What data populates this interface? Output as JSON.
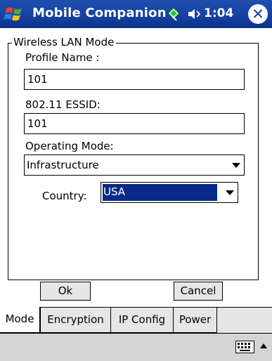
{
  "titlebar": {
    "app_title": "Mobile Companion",
    "clock": "1:04",
    "close_label": "✕",
    "start_icon": "windows-flag-icon",
    "connectivity_icon": "connectivity-icon",
    "volume_icon": "speaker-icon"
  },
  "form": {
    "group_label": "Wireless LAN Mode",
    "profile_name_label": "Profile Name :",
    "profile_name_value": "101",
    "essid_label": "802.11 ESSID:",
    "essid_value": "101",
    "operating_mode_label": "Operating Mode:",
    "operating_mode_value": "Infrastructure",
    "country_label": "Country:",
    "country_value": "USA"
  },
  "buttons": {
    "ok": "Ok",
    "cancel": "Cancel"
  },
  "tabs": [
    {
      "label": "Mode",
      "active": true
    },
    {
      "label": "Encryption",
      "active": false
    },
    {
      "label": "IP Config",
      "active": false
    },
    {
      "label": "Power",
      "active": false
    }
  ],
  "sip": {
    "keyboard_icon": "keyboard-icon",
    "arrow_icon": "up-arrow-icon"
  },
  "colors": {
    "titlebar": "#1440a0",
    "selection": "#0a2a8a",
    "tab_background": "#e6e6e6",
    "sip_background": "#d4d4d4"
  }
}
